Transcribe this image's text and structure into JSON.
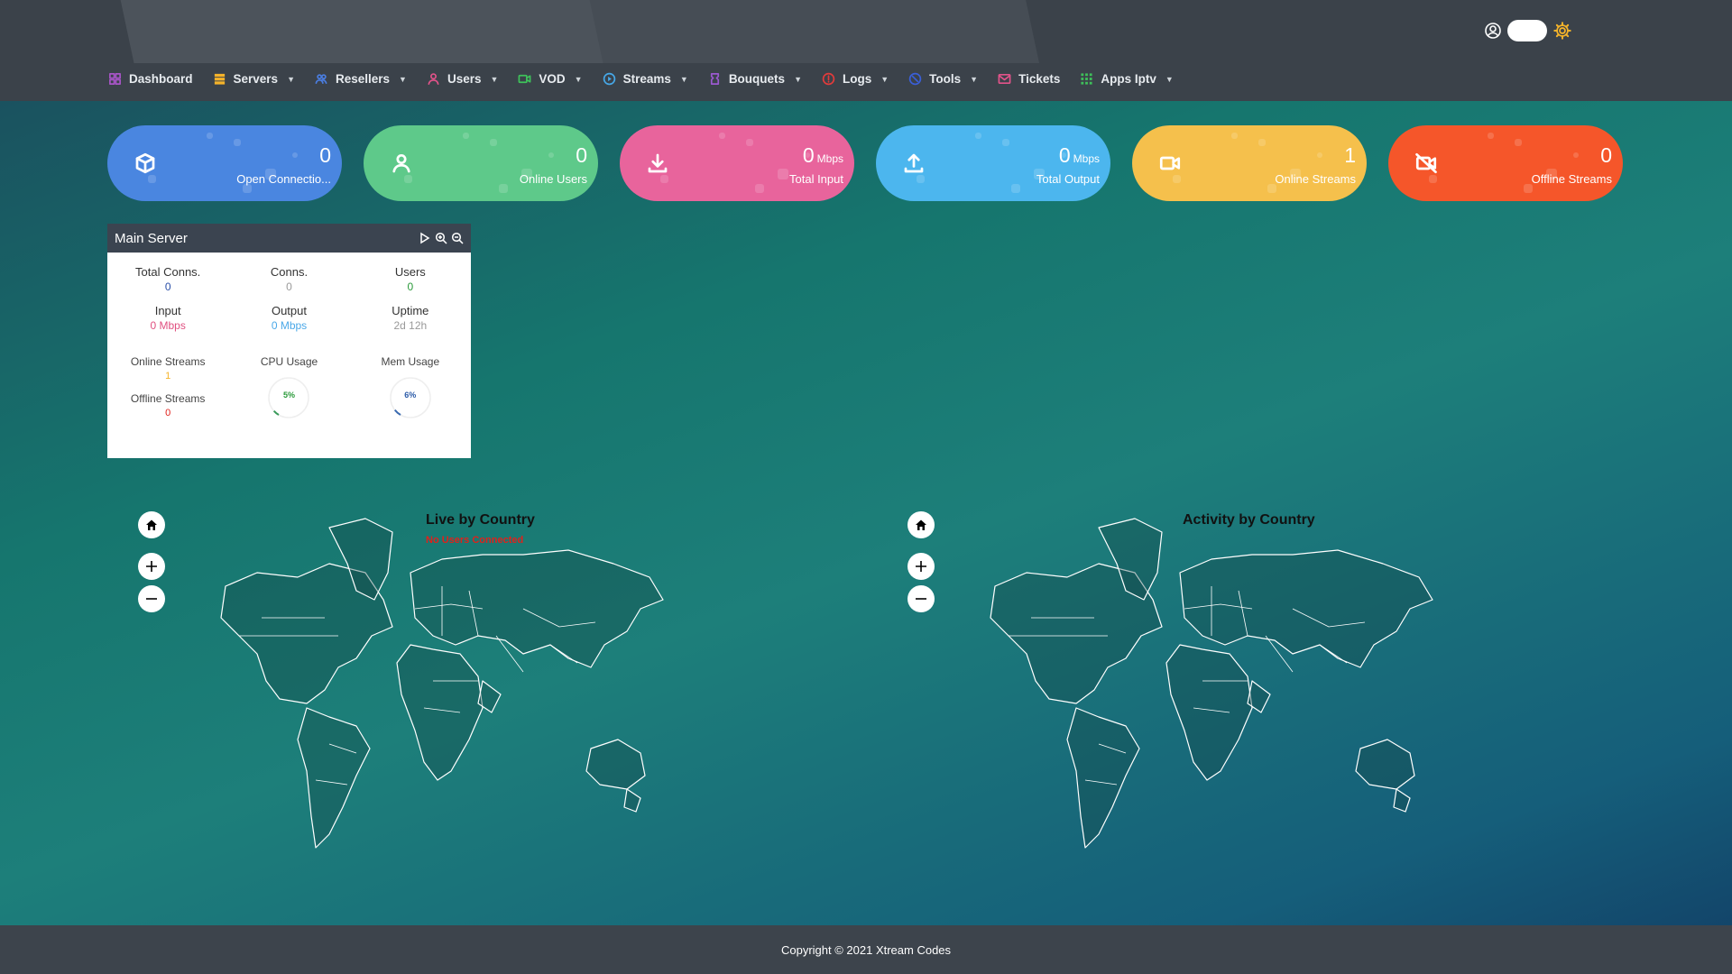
{
  "nav": {
    "items": [
      {
        "label": "Dashboard",
        "icon": "dashboard-icon",
        "color": "#a855c7",
        "caret": false
      },
      {
        "label": "Servers",
        "icon": "servers-icon",
        "color": "#f5b32a",
        "caret": true
      },
      {
        "label": "Resellers",
        "icon": "resellers-icon",
        "color": "#4a7de0",
        "caret": true
      },
      {
        "label": "Users",
        "icon": "users-icon",
        "color": "#e2538a",
        "caret": true
      },
      {
        "label": "VOD",
        "icon": "vod-icon",
        "color": "#3ec15a",
        "caret": true
      },
      {
        "label": "Streams",
        "icon": "streams-icon",
        "color": "#46a8e8",
        "caret": true
      },
      {
        "label": "Bouquets",
        "icon": "bouquets-icon",
        "color": "#9b59d0",
        "caret": true
      },
      {
        "label": "Logs",
        "icon": "logs-icon",
        "color": "#e23b3b",
        "caret": true
      },
      {
        "label": "Tools",
        "icon": "tools-icon",
        "color": "#3a5fd8",
        "caret": true
      },
      {
        "label": "Tickets",
        "icon": "tickets-icon",
        "color": "#e2538a",
        "caret": false
      },
      {
        "label": "Apps Iptv",
        "icon": "apps-grid-icon",
        "color": "#3ec15a",
        "caret": true
      }
    ]
  },
  "stats": [
    {
      "value": "0",
      "unit": "",
      "label": "Open Connectio...",
      "icon": "cube-icon",
      "color": "#4a86e0"
    },
    {
      "value": "0",
      "unit": "",
      "label": "Online Users",
      "icon": "users-icon",
      "color": "#5ec98a"
    },
    {
      "value": "0",
      "unit": "Mbps",
      "label": "Total Input",
      "icon": "download-icon",
      "color": "#e8649c"
    },
    {
      "value": "0",
      "unit": "Mbps",
      "label": "Total Output",
      "icon": "upload-icon",
      "color": "#4cb6ee"
    },
    {
      "value": "1",
      "unit": "",
      "label": "Online Streams",
      "icon": "video-icon",
      "color": "#f5c04c"
    },
    {
      "value": "0",
      "unit": "",
      "label": "Offline Streams",
      "icon": "video-off-icon",
      "color": "#f5562a"
    }
  ],
  "server": {
    "title": "Main Server",
    "total_conns_label": "Total Conns.",
    "total_conns": "0",
    "conns_label": "Conns.",
    "conns": "0",
    "users_label": "Users",
    "users": "0",
    "input_label": "Input",
    "input": "0 Mbps",
    "output_label": "Output",
    "output": "0 Mbps",
    "uptime_label": "Uptime",
    "uptime": "2d 12h",
    "online_streams_label": "Online Streams",
    "online_streams": "1",
    "offline_streams_label": "Offline Streams",
    "offline_streams": "0",
    "cpu_label": "CPU Usage",
    "cpu": "5%",
    "cpu_value": 5,
    "mem_label": "Mem Usage",
    "mem": "6%",
    "mem_value": 6
  },
  "maps": {
    "left_title": "Live by Country",
    "left_sub": "No Users Connected",
    "right_title": "Activity by Country"
  },
  "footer": {
    "copyright": "Copyright © 2021 Xtream Codes"
  }
}
